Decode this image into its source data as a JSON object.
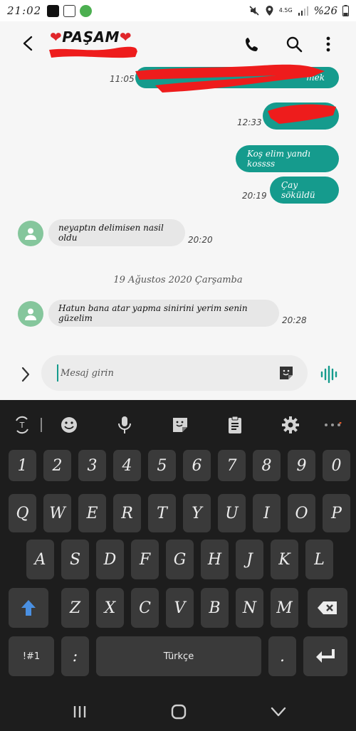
{
  "status_bar": {
    "time": "21:02",
    "network": "4.5G",
    "battery": "%26"
  },
  "header": {
    "contact_name": "PAŞAM",
    "heart_left": "❤",
    "heart_right": "❤"
  },
  "messages": [
    {
      "direction": "out",
      "text": "mek",
      "time": "11:05"
    },
    {
      "direction": "out",
      "text": "",
      "time": "12:33"
    },
    {
      "direction": "out",
      "text": "Koş elim yandı kossss",
      "time": ""
    },
    {
      "direction": "out",
      "text": "Çay söküldü",
      "time": "20:19"
    },
    {
      "direction": "in",
      "text": "neyaptın delimisen nasil oldu",
      "time": "20:20"
    },
    {
      "direction": "in",
      "text": "Hatun bana atar yapma sinirini yerim senin güzelim",
      "time": "20:28"
    }
  ],
  "date_separator": "19 Ağustos 2020 Çarşamba",
  "composer": {
    "placeholder": "Mesaj girin"
  },
  "keyboard": {
    "row_numbers": [
      "1",
      "2",
      "3",
      "4",
      "5",
      "6",
      "7",
      "8",
      "9",
      "0"
    ],
    "row_top": [
      "Q",
      "W",
      "E",
      "R",
      "T",
      "Y",
      "U",
      "I",
      "O",
      "P"
    ],
    "row_home": [
      "A",
      "S",
      "D",
      "F",
      "G",
      "H",
      "J",
      "K",
      "L"
    ],
    "row_bottom": [
      "Z",
      "X",
      "C",
      "V",
      "B",
      "N",
      "M"
    ],
    "symbols_key": "!#1",
    "colon_key": ":",
    "space_key": "Türkçe",
    "period_key": "."
  },
  "colors": {
    "accent": "#159b8d",
    "avatar": "#85c69c",
    "keyboard_bg": "#1d1d1d",
    "key_bg": "#3a3a3a",
    "redaction": "#ee1c1c"
  },
  "icons": [
    "back-arrow-icon",
    "phone-icon",
    "search-icon",
    "more-vertical-icon",
    "expand-icon",
    "sticker-icon",
    "voice-wave-icon",
    "translate-icon",
    "emoji-icon",
    "mic-icon",
    "sticker-icon",
    "clipboard-icon",
    "gear-icon",
    "more-horizontal-icon",
    "shift-icon",
    "backspace-icon",
    "enter-icon",
    "recents-icon",
    "home-icon",
    "back-icon"
  ]
}
